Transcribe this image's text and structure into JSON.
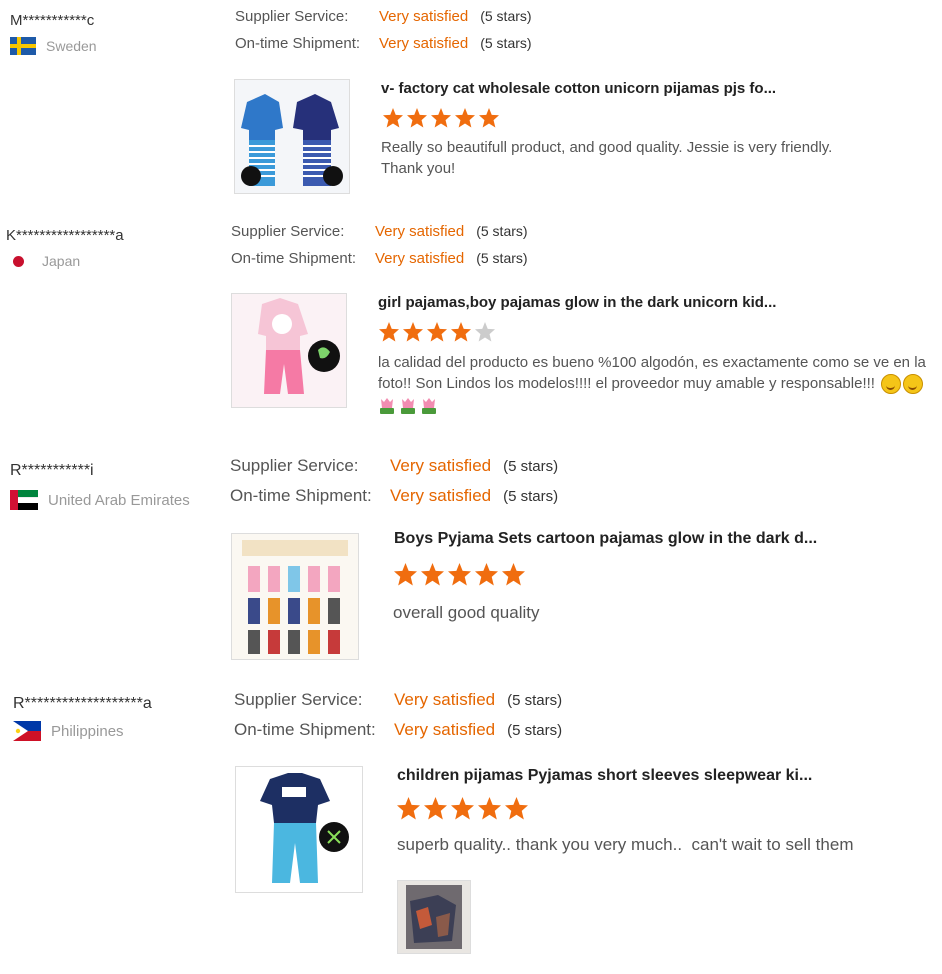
{
  "labels": {
    "supplier_service": "Supplier Service:",
    "on_time_shipment": "On-time Shipment:"
  },
  "reviews": [
    {
      "username": "M***********c",
      "country": "Sweden",
      "supplier_service": "Very satisfied",
      "supplier_stars": "(5 stars)",
      "shipment": "Very satisfied",
      "shipment_stars": "(5 stars)",
      "product_title": "v- factory cat wholesale cotton unicorn pijamas pjs fo...",
      "rating": 5,
      "comment": "Really so beautifull product, and good quality. Jessie is very friendly. Thank you!"
    },
    {
      "username": "K*****************a",
      "country": "Japan",
      "supplier_service": "Very satisfied",
      "supplier_stars": "(5 stars)",
      "shipment": "Very satisfied",
      "shipment_stars": "(5 stars)",
      "product_title": "girl pajamas,boy pajamas glow in the dark unicorn kid...",
      "rating": 4,
      "comment": "la calidad del producto es bueno %100 algodón, es exactamente como se ve en la foto!! Son Lindos los modelos!!!! el proveedor muy amable y responsable!!!"
    },
    {
      "username": "R***********i",
      "country": "United Arab Emirates",
      "supplier_service": "Very satisfied",
      "supplier_stars": "(5 stars)",
      "shipment": "Very satisfied",
      "shipment_stars": "(5 stars)",
      "product_title": "Boys Pyjama Sets cartoon pajamas glow in the dark d...",
      "rating": 5,
      "comment": "overall good quality"
    },
    {
      "username": "R*******************a",
      "country": "Philippines",
      "supplier_service": "Very satisfied",
      "supplier_stars": "(5 stars)",
      "shipment": "Very satisfied",
      "shipment_stars": "(5 stars)",
      "product_title": "children pijamas Pyjamas short sleeves sleepwear ki...",
      "rating": 5,
      "comment": "superb quality.. thank you very much..  can't wait to sell them"
    }
  ],
  "colors": {
    "accent": "#e56600",
    "star_filled": "#f06d0f",
    "star_empty": "#cccccc"
  }
}
